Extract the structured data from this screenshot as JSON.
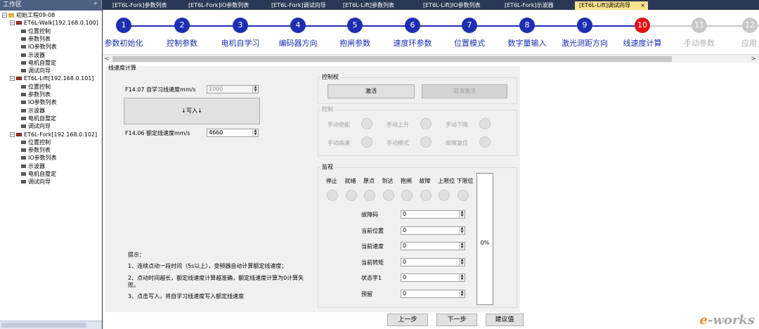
{
  "workspace": {
    "title": "工作区",
    "pin": "ᵖ",
    "tree": [
      {
        "label": "初始工程09-08",
        "kind": "root"
      },
      {
        "label": "ET6L-Walk[192.168.0.100]",
        "kind": "device"
      },
      {
        "label": "位置控制",
        "kind": "item"
      },
      {
        "label": "参数列表",
        "kind": "item"
      },
      {
        "label": "IO参数列表",
        "kind": "item"
      },
      {
        "label": "示波器",
        "kind": "item"
      },
      {
        "label": "电机自整定",
        "kind": "item"
      },
      {
        "label": "调试向导",
        "kind": "item"
      },
      {
        "label": "ET6L-Lift[192.168.0.101]",
        "kind": "device"
      },
      {
        "label": "位置控制",
        "kind": "item"
      },
      {
        "label": "参数列表",
        "kind": "item"
      },
      {
        "label": "IO参数列表",
        "kind": "item"
      },
      {
        "label": "示波器",
        "kind": "item"
      },
      {
        "label": "电机自整定",
        "kind": "item"
      },
      {
        "label": "调试向导",
        "kind": "item"
      },
      {
        "label": "ET6L-Fork[192.168.0.102]",
        "kind": "device"
      },
      {
        "label": "位置控制",
        "kind": "item"
      },
      {
        "label": "参数列表",
        "kind": "item"
      },
      {
        "label": "IO参数列表",
        "kind": "item"
      },
      {
        "label": "示波器",
        "kind": "item"
      },
      {
        "label": "电机自整定",
        "kind": "item"
      },
      {
        "label": "调试向导",
        "kind": "item"
      }
    ]
  },
  "tabs": [
    {
      "label": "[ET6L-Fork]参数列表"
    },
    {
      "label": "[ET6L-Fork]IO参数列表"
    },
    {
      "label": "[ET6L-Fork]调试向导"
    },
    {
      "label": "[ET6L-Lift]参数列表"
    },
    {
      "label": "[ET6L-Lift]IO参数列表"
    },
    {
      "label": "[ET6L-Fork]示波器"
    },
    {
      "label": "[ET6L-Lift]调试向导",
      "active": true
    }
  ],
  "tab_close": "×",
  "steps": [
    {
      "num": "1",
      "label": "参数初始化"
    },
    {
      "num": "2",
      "label": "控制参数"
    },
    {
      "num": "3",
      "label": "电机自学习"
    },
    {
      "num": "4",
      "label": "编码器方向"
    },
    {
      "num": "5",
      "label": "抱闸参数"
    },
    {
      "num": "6",
      "label": "速度环参数"
    },
    {
      "num": "7",
      "label": "位置模式"
    },
    {
      "num": "8",
      "label": "数字量输入"
    },
    {
      "num": "9",
      "label": "激光测距方向"
    },
    {
      "num": "10",
      "label": "线速度计算",
      "current": true
    },
    {
      "num": "11",
      "label": "手动参数",
      "disabled": true
    },
    {
      "num": "12",
      "label": "应用",
      "disabled": true
    }
  ],
  "scroll": {
    "left": "<",
    "right": ">"
  },
  "panel": {
    "title": "线速度计算",
    "f1407_label": "F14.07 自学习线速度mm/s",
    "f1407_value": "1000",
    "write_button": "↓写入↓",
    "f1406_label": "F14.06 额定线速度mm/s",
    "f1406_value": "4660",
    "tips_title": "提示：",
    "tips": [
      "1、连续点动一段时间（5s以上），变频器自动计算额定线速度；",
      "2、点动时间越长，额定线速度计算越准确，额定线速度计算为0计算失败。",
      "3、点击写入，将自学习线速度写入额定线速度"
    ]
  },
  "control_right": {
    "title": "控制权",
    "activate": "激活",
    "cancel_activate": "取消激活"
  },
  "control": {
    "title": "控制",
    "items": [
      {
        "label": "手动使能"
      },
      {
        "label": "手动上升"
      },
      {
        "label": "手动下降"
      },
      {
        "label": "手动高速"
      },
      {
        "label": "手动模式"
      },
      {
        "label": "故障复位"
      }
    ]
  },
  "monitor": {
    "title": "监视",
    "indicators": [
      "停止",
      "就绪",
      "原点",
      "到达",
      "抱闸",
      "故障",
      "上限位",
      "下限位"
    ],
    "fields": [
      {
        "label": "故障码",
        "value": "0"
      },
      {
        "label": "当前位置",
        "value": "0"
      },
      {
        "label": "当前速度",
        "value": "0"
      },
      {
        "label": "当前转矩",
        "value": "0"
      },
      {
        "label": "状态字1",
        "value": "0"
      },
      {
        "label": "预留",
        "value": "0"
      }
    ],
    "percent": "0%"
  },
  "nav": {
    "prev": "上一步",
    "next": "下一步",
    "suggest": "建议值"
  },
  "logo": {
    "e": "e",
    "rest": "-works"
  }
}
